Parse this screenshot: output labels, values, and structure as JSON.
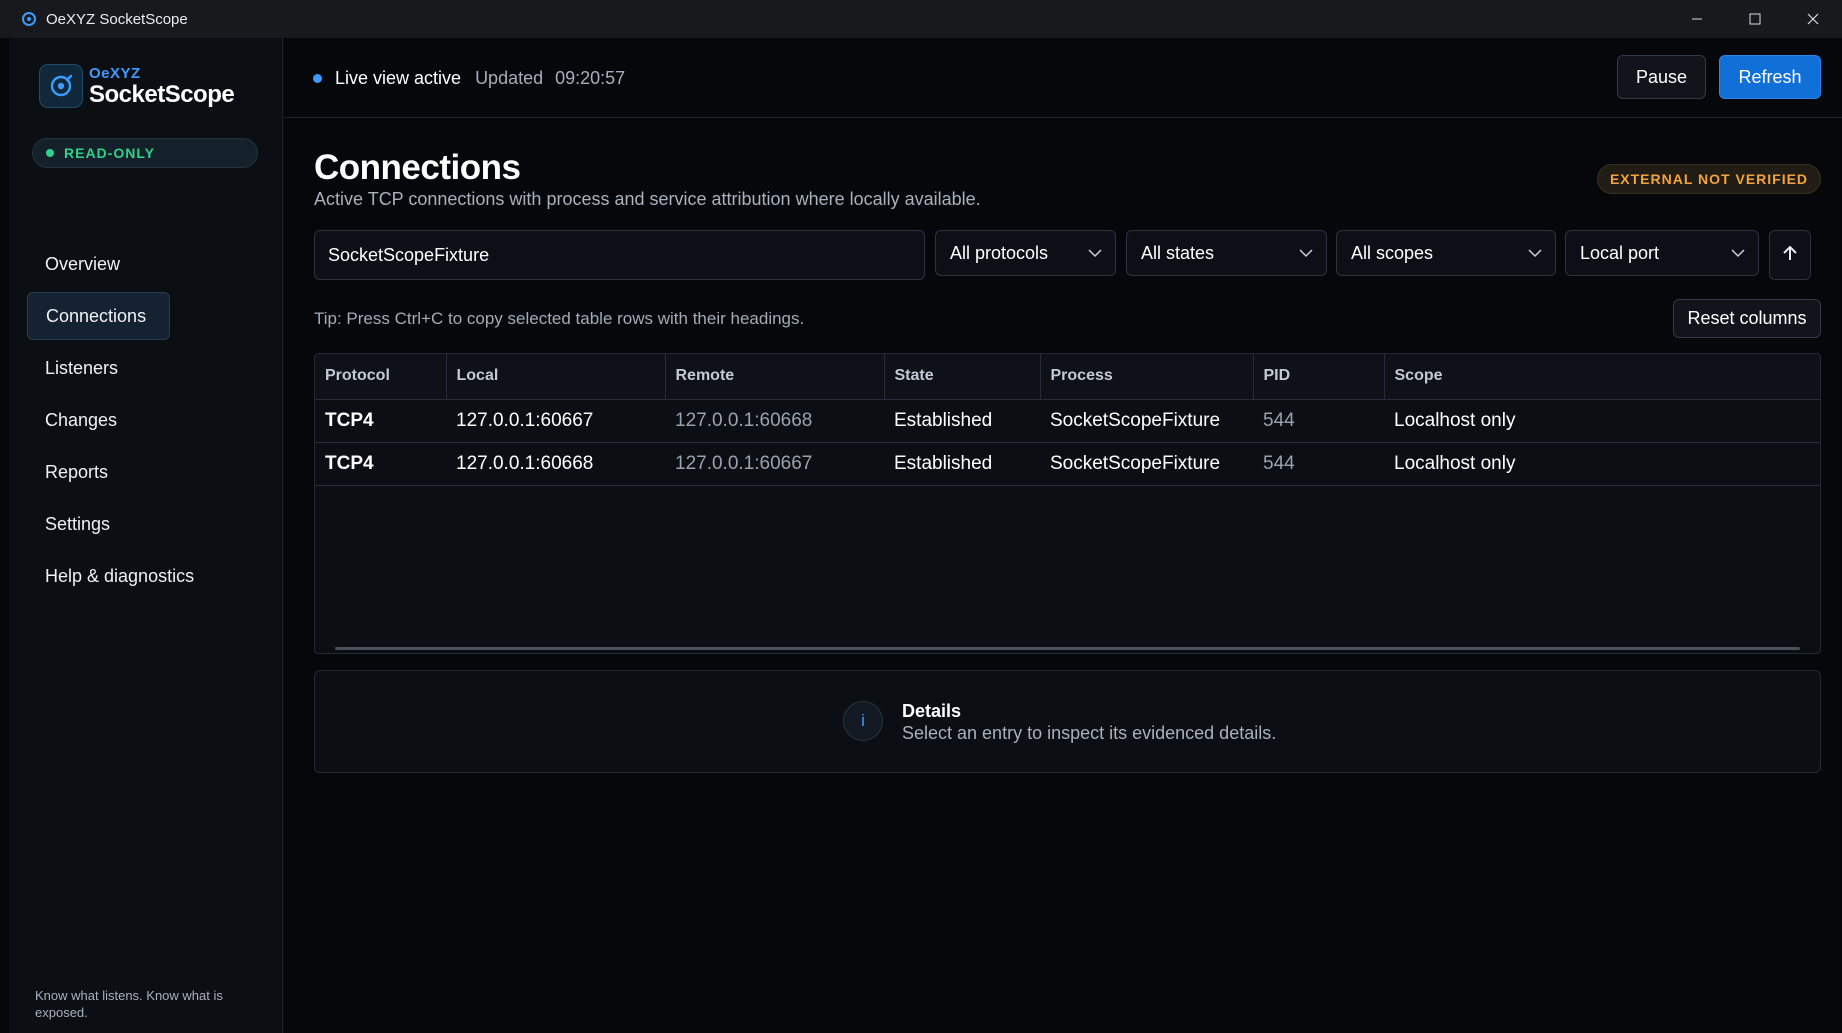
{
  "window": {
    "title": "OeXYZ SocketScope"
  },
  "brand": {
    "small": "OeXYZ",
    "big": "SocketScope"
  },
  "mode_badge": "READ-ONLY",
  "nav": [
    {
      "label": "Overview",
      "active": false
    },
    {
      "label": "Connections",
      "active": true
    },
    {
      "label": "Listeners",
      "active": false
    },
    {
      "label": "Changes",
      "active": false
    },
    {
      "label": "Reports",
      "active": false
    },
    {
      "label": "Settings",
      "active": false
    },
    {
      "label": "Help & diagnostics",
      "active": false
    }
  ],
  "tagline": "Know what listens. Know what is exposed.",
  "header": {
    "live_label": "Live view active",
    "updated_label": "Updated",
    "updated_time": "09:20:57",
    "pause_label": "Pause",
    "refresh_label": "Refresh"
  },
  "page": {
    "title": "Connections",
    "subtitle": "Active TCP connections with process and service attribution where locally available.",
    "external_badge": "EXTERNAL NOT VERIFIED"
  },
  "filters": {
    "search_value": "SocketScopeFixture",
    "protocol": "All protocols",
    "state": "All states",
    "scope": "All scopes",
    "sort_by": "Local port"
  },
  "tip": "Tip: Press Ctrl+C to copy selected table rows with their headings.",
  "reset_columns_label": "Reset columns",
  "table": {
    "columns": [
      "Protocol",
      "Local",
      "Remote",
      "State",
      "Process",
      "PID",
      "Scope"
    ],
    "rows": [
      [
        "TCP4",
        "127.0.0.1:60667",
        "127.0.0.1:60668",
        "Established",
        "SocketScopeFixture",
        "544",
        "Localhost only"
      ],
      [
        "TCP4",
        "127.0.0.1:60668",
        "127.0.0.1:60667",
        "Established",
        "SocketScopeFixture",
        "544",
        "Localhost only"
      ]
    ]
  },
  "details": {
    "title": "Details",
    "subtitle": "Select an entry to inspect its evidenced details."
  },
  "colors": {
    "accent": "#1170d8",
    "live_dot": "#3d9bff",
    "readonly": "#2fd28a",
    "warning": "#f2a33a"
  }
}
